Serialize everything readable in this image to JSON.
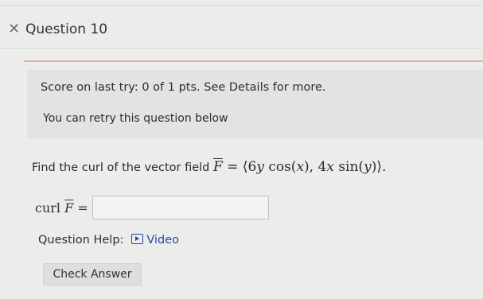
{
  "header": {
    "status_mark": "✕",
    "title": "Question 10"
  },
  "score": {
    "text": "Score on last try: 0 of 1 pts. See Details for more.",
    "retry": "You can retry this question below"
  },
  "question": {
    "prefix": "Find the curl of the vector field ",
    "F": "F",
    "equals": " = ",
    "lb": "⟨",
    "c1": "6",
    "v1": "y",
    "f1": " cos(",
    "v2": "x",
    "p1": "), ",
    "c2": "4",
    "v3": "x",
    "f2": " sin(",
    "v4": "y",
    "p2": ")",
    "rb": "⟩",
    "period": "."
  },
  "answer": {
    "label_curl": "curl ",
    "label_F": "F",
    "label_eq": " =",
    "value": ""
  },
  "help": {
    "label": "Question Help:",
    "video": "Video"
  },
  "actions": {
    "check_label": "Check Answer"
  },
  "icons": {
    "status": "x-icon",
    "video": "video-play-icon"
  }
}
